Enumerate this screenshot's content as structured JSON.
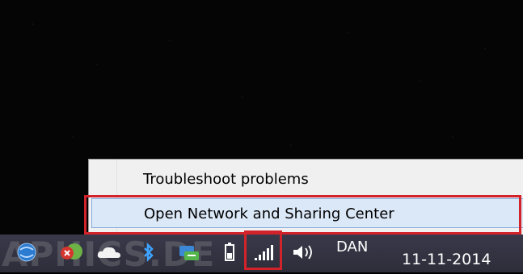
{
  "context_menu": {
    "items": [
      {
        "label": "Troubleshoot problems"
      },
      {
        "label": "Open Network and Sharing Center"
      }
    ]
  },
  "taskbar": {
    "tray_icons": [
      "network-globe-icon",
      "security-alert-icon",
      "onedrive-cloud-icon",
      "bluetooth-icon",
      "sync-icon",
      "battery-icon",
      "wifi-signal-icon",
      "volume-icon"
    ],
    "language": "DAN",
    "date": "11-11-2014"
  },
  "watermark": "APHICS.DE",
  "colors": {
    "highlight_frame": "#d2232a",
    "menu_hover": "#dbe8f7",
    "taskbar": "#33333f"
  }
}
